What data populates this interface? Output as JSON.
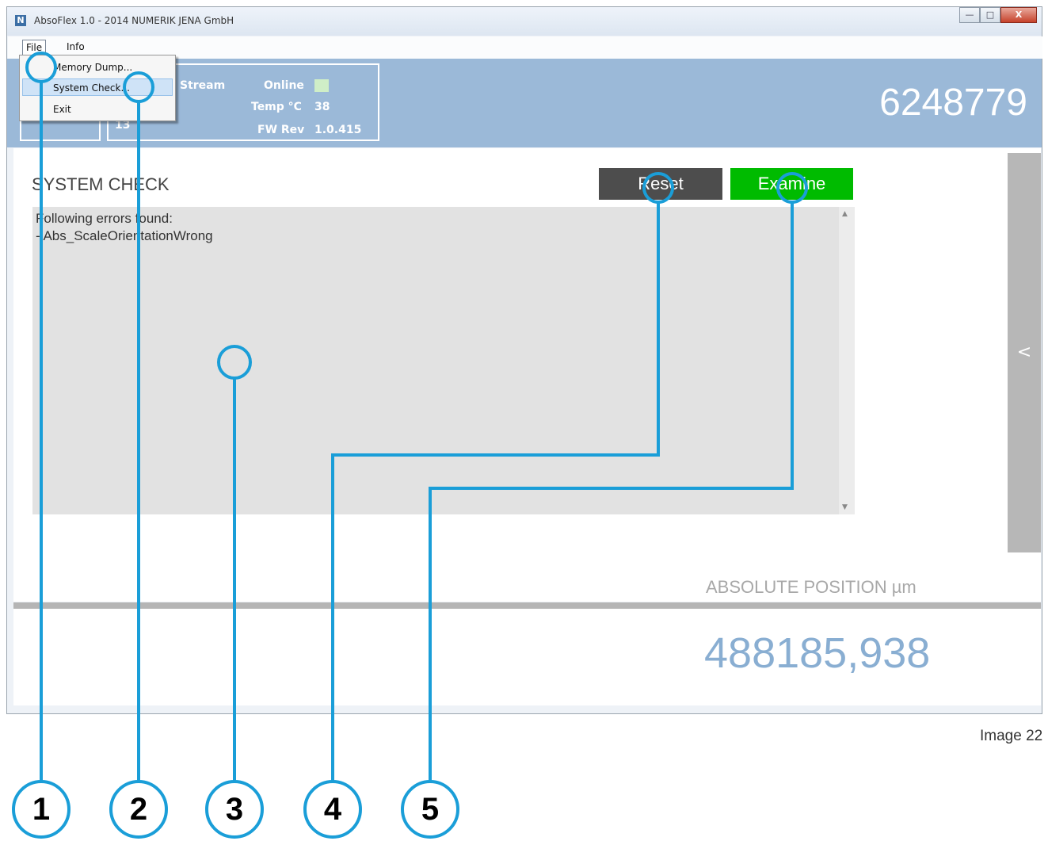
{
  "window": {
    "title": "AbsoFlex 1.0 - 2014 NUMERIK JENA GmbH",
    "app_icon_letter": "N",
    "buttons": {
      "minimize": "—",
      "maximize": "□",
      "close": "X"
    }
  },
  "menubar": {
    "file_label": "File",
    "info_label": "Info"
  },
  "file_menu": {
    "items": [
      "Memory Dump...",
      "System Check...",
      "Exit"
    ],
    "highlighted": "System Check..."
  },
  "header": {
    "stream_label": "Stream",
    "online_label": "Online",
    "online_color": "#cfeec7",
    "temp_label": "Temp °C",
    "temp_value": "38",
    "fw_label": "FW Rev",
    "fw_value": "1.0.415",
    "box1_partial": "",
    "box2_partial": "13",
    "serial_number": "6248779"
  },
  "system_check": {
    "title": "SYSTEM CHECK",
    "reset_label": "Reset",
    "examine_label": "Examine",
    "errors_intro": "Following errors found:",
    "error_line": "- Abs_ScaleOrientationWrong"
  },
  "side_toggle_label": "<",
  "position": {
    "label": "ABSOLUTE POSITION µm",
    "value": "488185,938"
  },
  "caption": "Image 22",
  "callouts": [
    "1",
    "2",
    "3",
    "4",
    "5"
  ],
  "colors": {
    "header_bg": "#9bb9d8",
    "reset_bg": "#4d4d4d",
    "examine_bg": "#00bb00",
    "callout": "#1a9ed8",
    "position_value": "#89aed2"
  }
}
